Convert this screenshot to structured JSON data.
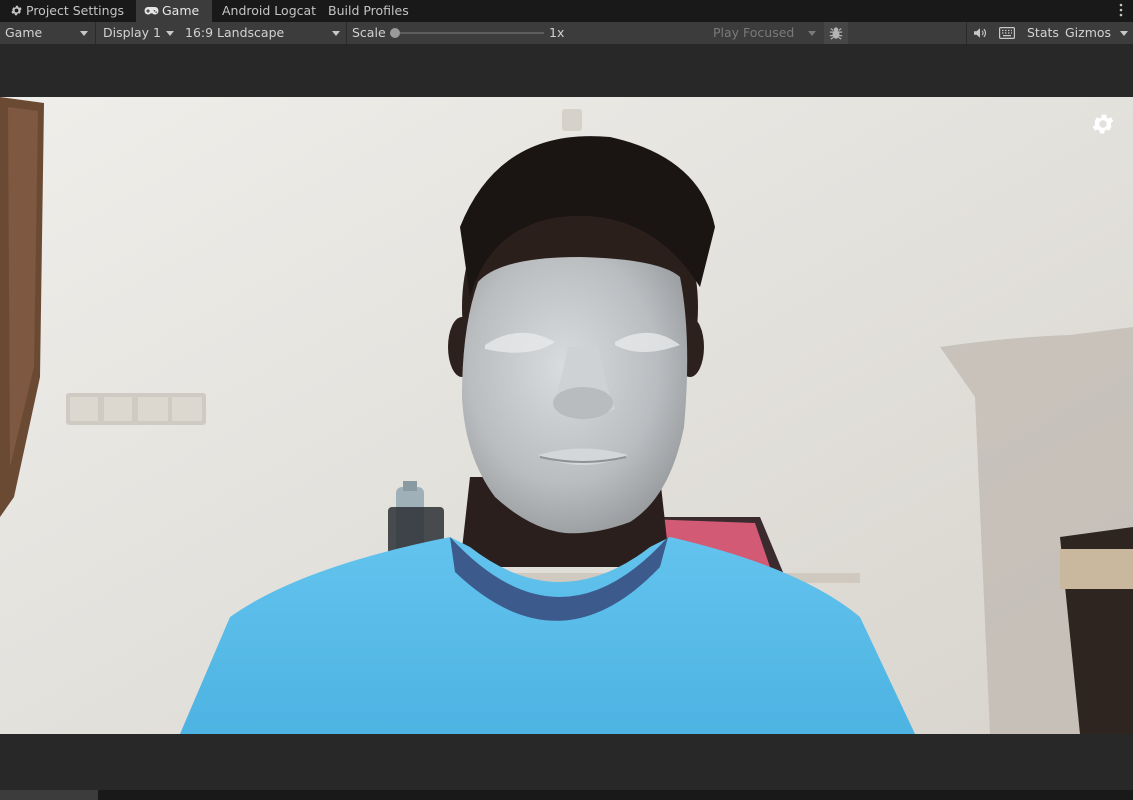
{
  "tabs": [
    {
      "label": "Project Settings",
      "icon": "gear-icon",
      "active": false
    },
    {
      "label": "Game",
      "icon": "gamepad-icon",
      "active": true
    },
    {
      "label": "Android Logcat",
      "active": false
    },
    {
      "label": "Build Profiles",
      "active": false
    }
  ],
  "toolbar": {
    "view_mode": "Game",
    "display": "Display 1",
    "aspect": "16:9 Landscape",
    "scale_label": "Scale",
    "scale_value": "1x",
    "scale_fraction": 0.0,
    "play_mode": "Play Focused",
    "stats_label": "Stats",
    "gizmos_label": "Gizmos",
    "icons": [
      "bug-icon",
      "speaker-icon",
      "keyboard-icon"
    ]
  },
  "viewport": {
    "overlay_icon": "gear-icon"
  },
  "colors": {
    "panel_bg": "#282828",
    "tabbar_bg": "#191919",
    "toolbar_bg": "#3c3c3c",
    "shirt": "#5bbde8",
    "mask": "#bfc3c6"
  }
}
